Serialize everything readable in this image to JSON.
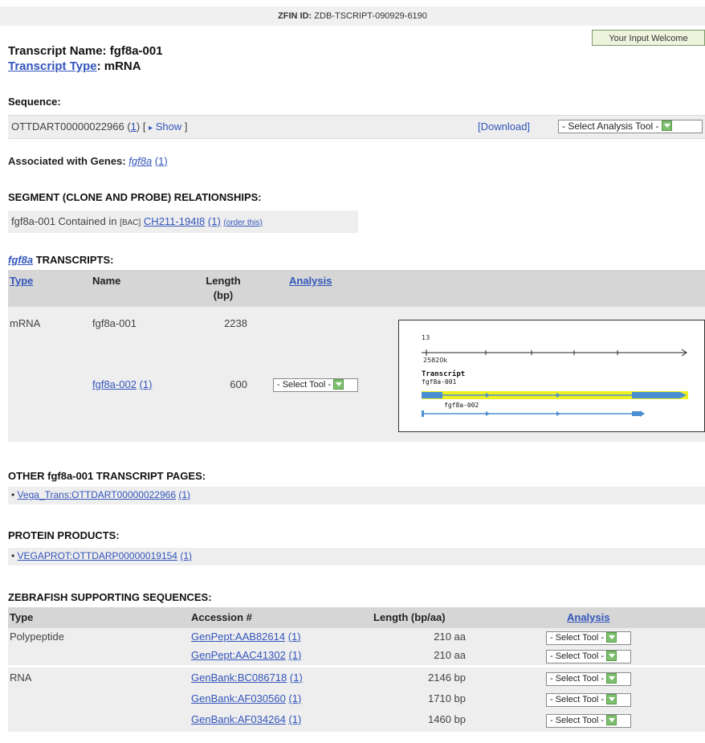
{
  "header": {
    "zfin_label": "ZFIN ID:",
    "zfin_id": "ZDB-TSCRIPT-090929-6190",
    "input_button": "Your Input Welcome"
  },
  "title": {
    "name_label": "Transcript Name:",
    "name_value": "fgf8a-001",
    "type_link": "Transcript Type",
    "type_sep": ":",
    "type_value": "mRNA"
  },
  "sequence": {
    "heading": "Sequence:",
    "id": "OTTDART00000022966",
    "count_open": "(",
    "count": "1",
    "count_close": ")",
    "show_open": "[",
    "show_arrow": "▸",
    "show": "Show",
    "show_close": "]",
    "download": "[Download]",
    "tool": "- Select Analysis Tool -"
  },
  "associated": {
    "label": "Associated with Genes:",
    "gene": "fgf8a",
    "count": "(1)"
  },
  "segment": {
    "heading": "SEGMENT (CLONE AND PROBE) RELATIONSHIPS:",
    "text": "fgf8a-001 Contained in",
    "bac": "[BAC]",
    "clone": "CH211-194I8",
    "count": "(1)",
    "order": "(order this)"
  },
  "transcripts": {
    "gene": "fgf8a",
    "heading_rest": "TRANSCRIPTS:",
    "columns": {
      "type": "Type",
      "name": "Name",
      "length": "Length",
      "length_unit": "(bp)",
      "analysis": "Analysis"
    },
    "rows": [
      {
        "type": "mRNA",
        "name": "fgf8a-001",
        "count": "",
        "length": "2238",
        "tool": ""
      },
      {
        "type": "",
        "name": "fgf8a-002",
        "count": "(1)",
        "length": "600",
        "tool": "- Select Tool -"
      }
    ],
    "diagram": {
      "chrom": "13",
      "coord": "25820k",
      "track_label": "Transcript",
      "t1": "fgf8a-001",
      "t2": "fgf8a-002",
      "highlight_color": "#eeee22",
      "feature_color": "#4a90d0"
    }
  },
  "other_pages": {
    "heading": "OTHER fgf8a-001 TRANSCRIPT PAGES:",
    "item": "Vega_Trans:OTTDART00000022966",
    "count": "(1)"
  },
  "protein": {
    "heading": "PROTEIN PRODUCTS:",
    "item": "VEGAPROT:OTTDARP00000019154",
    "count": "(1)"
  },
  "supporting": {
    "heading": "ZEBRAFISH SUPPORTING SEQUENCES:",
    "columns": {
      "type": "Type",
      "accession": "Accession #",
      "length": "Length (bp/aa)",
      "analysis": "Analysis"
    },
    "rows": [
      {
        "type": "Polypeptide",
        "acc": "GenPept:AAB82614",
        "count": "(1)",
        "length": "210 aa",
        "tool": "- Select Tool -"
      },
      {
        "type": "",
        "acc": "GenPept:AAC41302",
        "count": "(1)",
        "length": "210 aa",
        "tool": "- Select Tool -"
      },
      {
        "type": "RNA",
        "acc": "GenBank:BC086718",
        "count": "(1)",
        "length": "2146 bp",
        "tool": "- Select Tool -"
      },
      {
        "type": "",
        "acc": "GenBank:AF030560",
        "count": "(1)",
        "length": "1710 bp",
        "tool": "- Select Tool -"
      },
      {
        "type": "",
        "acc": "GenBank:AF034264",
        "count": "(1)",
        "length": "1460 bp",
        "tool": "- Select Tool -"
      }
    ]
  }
}
